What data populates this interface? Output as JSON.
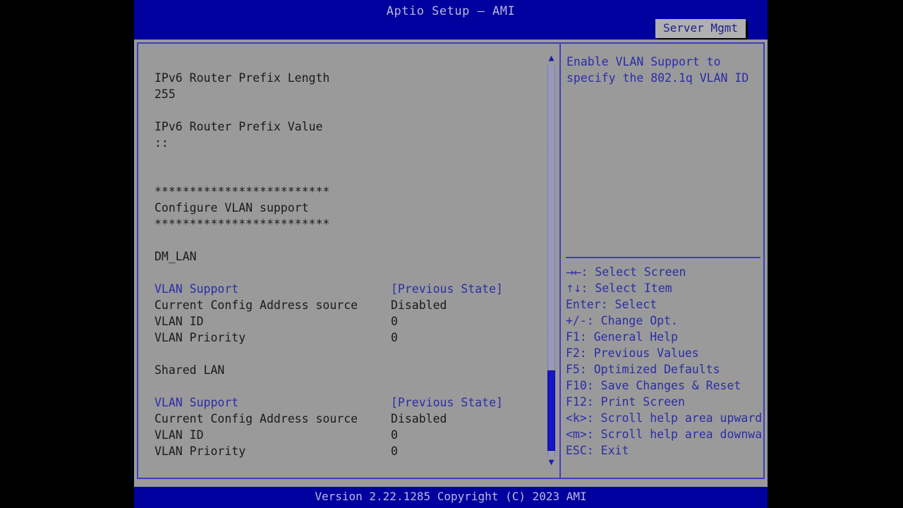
{
  "window": {
    "title": "Aptio Setup – AMI",
    "accent_blue": "#00009e",
    "panel_bg": "#9a9a9a",
    "text_color": "#1a1a1a",
    "highlight_color": "#2c2ca8"
  },
  "tabs": [
    {
      "label": "Server Mgmt",
      "active": true
    }
  ],
  "settings": {
    "rows": [
      {
        "label": "IPv6 Router Prefix Length",
        "value": "",
        "label_color": "black",
        "value_color": "black",
        "interactable": false
      },
      {
        "label": "255",
        "value": "",
        "label_color": "black",
        "value_color": "black",
        "interactable": false
      },
      {
        "label": "",
        "value": "",
        "label_color": "black",
        "value_color": "black",
        "interactable": false
      },
      {
        "label": "IPv6 Router Prefix Value",
        "value": "",
        "label_color": "black",
        "value_color": "black",
        "interactable": false
      },
      {
        "label": "::",
        "value": "",
        "label_color": "black",
        "value_color": "black",
        "interactable": false
      },
      {
        "label": "",
        "value": "",
        "label_color": "black",
        "value_color": "black",
        "interactable": false
      },
      {
        "label": "",
        "value": "",
        "label_color": "black",
        "value_color": "black",
        "interactable": false
      },
      {
        "label": "*************************",
        "value": "",
        "label_color": "black",
        "value_color": "black",
        "interactable": false
      },
      {
        "label": "Configure VLAN support",
        "value": "",
        "label_color": "black",
        "value_color": "black",
        "interactable": false
      },
      {
        "label": "*************************",
        "value": "",
        "label_color": "black",
        "value_color": "black",
        "interactable": false
      },
      {
        "label": "",
        "value": "",
        "label_color": "black",
        "value_color": "black",
        "interactable": false
      },
      {
        "label": "DM_LAN",
        "value": "",
        "label_color": "black",
        "value_color": "black",
        "interactable": false
      },
      {
        "label": "",
        "value": "",
        "label_color": "black",
        "value_color": "black",
        "interactable": false
      },
      {
        "label": "VLAN Support",
        "value": "[Previous State]",
        "label_color": "blue",
        "value_color": "blue",
        "interactable": true
      },
      {
        "label": "Current Config Address source",
        "value": "Disabled",
        "label_color": "black",
        "value_color": "black",
        "interactable": false
      },
      {
        "label": "VLAN ID",
        "value": "0",
        "label_color": "black",
        "value_color": "black",
        "interactable": false
      },
      {
        "label": "VLAN Priority",
        "value": "0",
        "label_color": "black",
        "value_color": "black",
        "interactable": false
      },
      {
        "label": "",
        "value": "",
        "label_color": "black",
        "value_color": "black",
        "interactable": false
      },
      {
        "label": "Shared LAN",
        "value": "",
        "label_color": "black",
        "value_color": "black",
        "interactable": false
      },
      {
        "label": "",
        "value": "",
        "label_color": "black",
        "value_color": "black",
        "interactable": false
      },
      {
        "label": "VLAN Support",
        "value": "[Previous State]",
        "label_color": "blue",
        "value_color": "blue",
        "interactable": true
      },
      {
        "label": "Current Config Address source",
        "value": "Disabled",
        "label_color": "black",
        "value_color": "black",
        "interactable": false
      },
      {
        "label": "VLAN ID",
        "value": "0",
        "label_color": "black",
        "value_color": "black",
        "interactable": false
      },
      {
        "label": "VLAN Priority",
        "value": "0",
        "label_color": "black",
        "value_color": "black",
        "interactable": false
      }
    ]
  },
  "scrollbar": {
    "up_arrow": "▲",
    "down_arrow": "▼"
  },
  "help": {
    "text": "Enable VLAN Support to specify the 802.1q VLAN ID",
    "keys": [
      {
        "sym": "→←",
        "text": ": Select Screen"
      },
      {
        "sym": "↑↓",
        "text": ": Select Item"
      },
      {
        "sym": "",
        "text": "Enter: Select"
      },
      {
        "sym": "",
        "text": "+/-: Change Opt."
      },
      {
        "sym": "",
        "text": "F1: General Help"
      },
      {
        "sym": "",
        "text": "F2: Previous Values"
      },
      {
        "sym": "",
        "text": "F5: Optimized Defaults"
      },
      {
        "sym": "",
        "text": "F10: Save Changes & Reset"
      },
      {
        "sym": "",
        "text": "F12: Print Screen"
      },
      {
        "sym": "",
        "text": "<k>: Scroll help area upwards"
      },
      {
        "sym": "",
        "text": "<m>: Scroll help area downwards"
      },
      {
        "sym": "",
        "text": "ESC: Exit"
      }
    ]
  },
  "footer": {
    "text": "Version 2.22.1285 Copyright (C) 2023 AMI"
  }
}
